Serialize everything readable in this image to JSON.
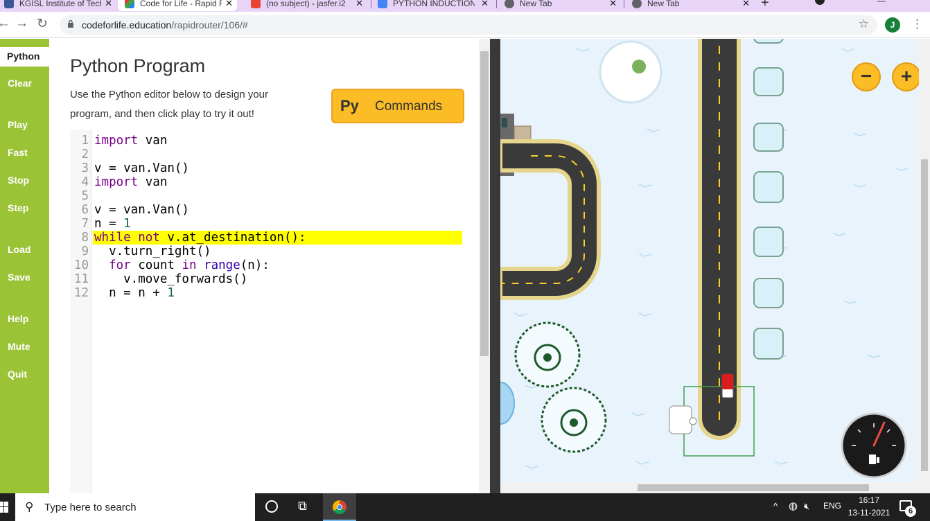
{
  "browser": {
    "tabs": [
      {
        "title": "KGISL Institute of Tech",
        "active": false
      },
      {
        "title": "Code for Life - Rapid R",
        "active": true
      },
      {
        "title": "(no subject) - jasfer.i2",
        "active": false
      },
      {
        "title": "PYTHON INDUCTION",
        "active": false
      },
      {
        "title": "New Tab",
        "active": false
      },
      {
        "title": "New Tab",
        "active": false
      }
    ],
    "new_tab_label": "+",
    "url_host": "codeforlife.education",
    "url_path": "/rapidrouter/106/#",
    "profile_initial": "J"
  },
  "sidebar": {
    "items": [
      "Python",
      "Clear",
      "Play",
      "Fast",
      "Stop",
      "Step",
      "Load",
      "Save",
      "Help",
      "Mute",
      "Quit"
    ]
  },
  "editor": {
    "title": "Python Program",
    "description": "Use the Python editor below to design your program, and then click play to try it out!",
    "commands_icon_text": "Py",
    "commands_label": "Commands",
    "line_numbers": [
      "1",
      "2",
      "3",
      "4",
      "5",
      "6",
      "7",
      "8",
      "9",
      "10",
      "11",
      "12"
    ],
    "highlighted_line": 8,
    "lines": [
      "import van",
      "",
      "v = van.Van()",
      "import van",
      "",
      "v = van.Van()",
      "n = 1",
      "while not v.at_destination():",
      "  v.turn_right()",
      "  for count in range(n):",
      "    v.move_forwards()",
      "  n = n + 1"
    ]
  },
  "game": {
    "zoom_out_label": "−",
    "zoom_in_label": "+"
  },
  "taskbar": {
    "search_placeholder": "Type here to search",
    "language": "ENG",
    "time": "16:17",
    "date": "13-11-2021",
    "notification_count": "6"
  },
  "colors": {
    "sidebar": "#9bc336",
    "accent": "#fbbc25",
    "highlight": "#ffff00",
    "tab_strip": "#e7d4f7"
  }
}
